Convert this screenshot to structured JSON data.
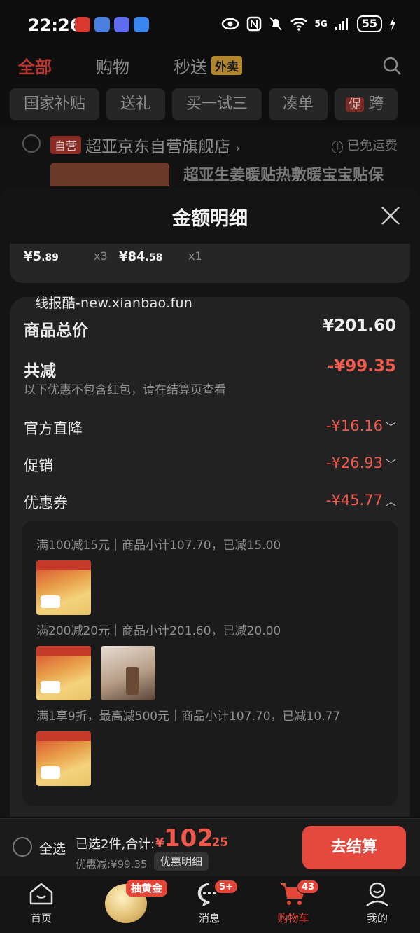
{
  "status_bar": {
    "time": "22:26",
    "network": "5G",
    "battery": "55"
  },
  "top_tabs": {
    "all": "全部",
    "shopping": "购物",
    "express": "秒送",
    "express_badge": "外卖"
  },
  "chips": [
    "国家补贴",
    "送礼",
    "买一试三",
    "凑单",
    "跨"
  ],
  "chip_promo_tag": "促",
  "shop": {
    "self_tag": "自营",
    "name": "超亚京东自营旗舰店",
    "shipping": "已免运费",
    "product_title": "超亚生姜暖贴热敷暖宝宝贴保"
  },
  "sheet": {
    "title": "金额明细",
    "items": [
      {
        "yen": "¥",
        "int": "5",
        "dec": ".89",
        "qty": "x3"
      },
      {
        "yen": "¥",
        "int": "84",
        "dec": ".58",
        "qty": "x1"
      }
    ],
    "watermark": "线报酷-new.xianbao.fun",
    "total_label": "商品总价",
    "total_value": "¥201.60",
    "reduction_label": "共减",
    "reduction_value": "-¥99.35",
    "note": "以下优惠不包含红包，请在结算页查看",
    "official_label": "官方直降",
    "official_value": "-¥16.16",
    "promo_label": "促销",
    "promo_value": "-¥26.93",
    "coupon_label": "优惠券",
    "coupon_value": "-¥45.77",
    "coupons": [
      "满100减15元｜商品小计107.70，已减15.00",
      "满200减20元｜商品小计201.60，已减20.00",
      "满1享9折，最高减500元｜商品小计107.70，已减10.77"
    ]
  },
  "checkout": {
    "select_all": "全选",
    "summary": "已选2件,合计:",
    "currency": "¥",
    "total_int": "102",
    "total_dec": ".25",
    "saving": "优惠减:¥99.35",
    "detail_button": "优惠明细",
    "go_button": "去结算"
  },
  "nav": {
    "home": "首页",
    "gold_badge": "抽黄金",
    "messages": "消息",
    "messages_badge": "5+",
    "cart": "购物车",
    "cart_badge": "43",
    "me": "我的"
  },
  "colors": {
    "accent_red": "#f25a4d",
    "button_red": "#e5483c",
    "express_badge": "#b2872b"
  }
}
